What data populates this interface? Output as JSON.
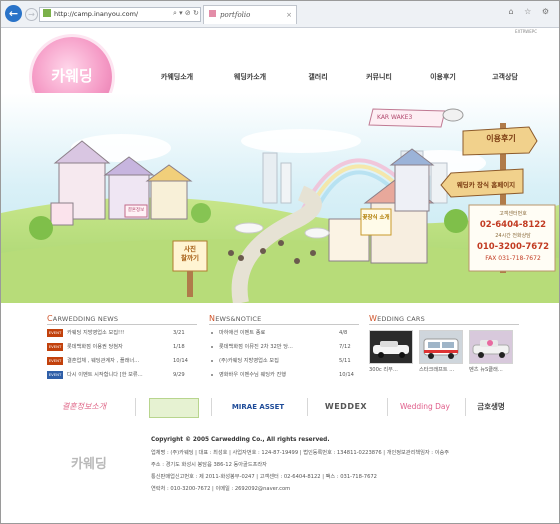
{
  "browser": {
    "url": "http://camp.inanyou.com/",
    "tab_title": "portfolio",
    "tab_close": "×",
    "address_tools": "⌕ ▾ ⊘ ↻",
    "top_right_icons": "⌂ ☆ ⚙",
    "tiny_top_text": "EXTRWEPC"
  },
  "logo_text": "카웨딩",
  "nav": [
    "카웨딩소개",
    "웨딩카소개",
    "갤러리",
    "커뮤니티",
    "이용후기",
    "고객상담"
  ],
  "hero": {
    "banner": "KAR WAKE3",
    "sign_top": "이용후기",
    "sign_bottom": "웨딩카 장식 홈페이지",
    "phone_block": [
      "고객센터번호",
      "02-6404-8122",
      "24시간 전화상담",
      "010-3200-7672",
      "FAX 031-718-7672"
    ],
    "house_sign_left": "결혼정보",
    "house_sign_center": "꽃장식 소개",
    "post_sign": [
      "사진",
      "찰까기"
    ]
  },
  "news": {
    "title_big": "C",
    "title_rest": "ARWEDDING NEWS",
    "items": [
      {
        "badge": "EVENT",
        "title": "카웨딩 지방영업소 모집!!!",
        "date": "3/21"
      },
      {
        "badge": "EVENT",
        "title": "롯데백화점 이용권 당첨자",
        "date": "1/18"
      },
      {
        "badge": "EVENT",
        "title": "결혼업체 , 웨딩관계자 , 플래너...",
        "date": "10/14"
      },
      {
        "badge": "EVENT",
        "title": "다시 이벤트 시작합니다 [한 보류...",
        "date": "9/29"
      }
    ]
  },
  "notice": {
    "title_big": "N",
    "title_rest": "EWS&NOTICE",
    "items": [
      {
        "title": "마하애션 이벤트 종료",
        "date": "4/8"
      },
      {
        "title": "롯데백화점 이뮤진 2차 32만 당...",
        "date": "7/12"
      },
      {
        "title": "(주)카웨딩 지방영업소 모집",
        "date": "5/11"
      },
      {
        "title": "영화바우 이벤수님 웨딩카 진행",
        "date": "10/14"
      }
    ]
  },
  "cars": {
    "title_big": "W",
    "title_rest": "EDDING CARS",
    "items": [
      {
        "caption": "300c 리무...",
        "color": "#e9e9e9"
      },
      {
        "caption": "스타크래프트 ...",
        "color": "#f2f2f2"
      },
      {
        "caption": "벤츠 뉴S클래...",
        "color": "#d8c9dc"
      }
    ]
  },
  "partners": [
    {
      "label": "결혼정보소개",
      "color": "#e06b8b"
    },
    {
      "label": "",
      "color": "#8fbf5a"
    },
    {
      "label": "MIRAE ASSET",
      "color": "#1f4c99"
    },
    {
      "label": "WEDDEX",
      "color": "#555555"
    },
    {
      "label": "Wedding Day",
      "color": "#e05d8a"
    },
    {
      "label": "금호생명",
      "color": "#444444"
    }
  ],
  "footer": {
    "logo": "카웨딩",
    "copyright": "Copyright © 2005 Carwedding Co., All rights reserved.",
    "lines": [
      "업체명 : (주)카웨딩 | 대표 : 최성호 | 사업자번호 : 124-87-19499 | 법인등록번호 : 134811-0223876 | 개인정보관리책임자 : 이승주",
      "주소 : 경기도 화성시 봉담읍 386-12 동아골드프라자",
      "통신판매업신고번호 : 제 2011-화성봉부-0247 | 고객센터 : 02-6404-8122 | 팩스 : 031-718-7672",
      "연락처 : 010-3200-7672 | 이메일 : 2692092@naver.com"
    ]
  }
}
